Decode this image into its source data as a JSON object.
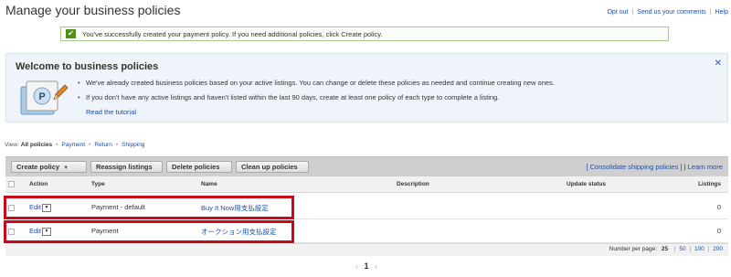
{
  "page": {
    "title": "Manage your business policies",
    "top_links": {
      "opt_out": "Opt out",
      "send_comments": "Send us your comments",
      "help": "Help"
    }
  },
  "success": {
    "message": "You've successfully created your payment policy. If you need additional policies, click Create policy."
  },
  "welcome": {
    "title": "Welcome to business policies",
    "bullets": [
      "We've already created business policies based on your active listings. You can change or delete these policies as needed and continue creating new ones.",
      "If you don't have any active listings and haven't listed within the last 90 days, create at least one policy of each type to complete a listing."
    ],
    "tutorial_link": "Read the tutorial",
    "close_glyph": "✕",
    "illustration_letter": "P"
  },
  "view": {
    "label": "View:",
    "all": "All policies",
    "payment": "Payment",
    "return": "Return",
    "shipping": "Shipping"
  },
  "toolbar": {
    "create_policy": "Create policy",
    "reassign_listings": "Reassign listings",
    "delete_policies": "Delete policies",
    "clean_up_policies": "Clean up policies",
    "consolidate": "[ Consolidate shipping policies ]",
    "learn_more": "Learn more"
  },
  "table": {
    "headers": {
      "action": "Action",
      "type": "Type",
      "name": "Name",
      "description": "Description",
      "update_status": "Update status",
      "listings": "Listings"
    },
    "rows": [
      {
        "action": "Edit",
        "type": "Payment - default",
        "name": "Buy It Now用支払設定",
        "description": "",
        "update_status": "",
        "listings": "0"
      },
      {
        "action": "Edit",
        "type": "Payment",
        "name": "オークション用支払設定",
        "description": "",
        "update_status": "",
        "listings": "0"
      }
    ]
  },
  "footer": {
    "per_page_label": "Number per page:",
    "current": "25",
    "options": [
      "50",
      "100",
      "200"
    ]
  },
  "pager": {
    "prev": "‹",
    "page": "1",
    "next": "›"
  },
  "colors": {
    "success_green": "#4f8f1c",
    "link_blue": "#1f4ea8",
    "highlight_red": "#c8091a",
    "toolbar_gray": "#cfcfcf"
  }
}
